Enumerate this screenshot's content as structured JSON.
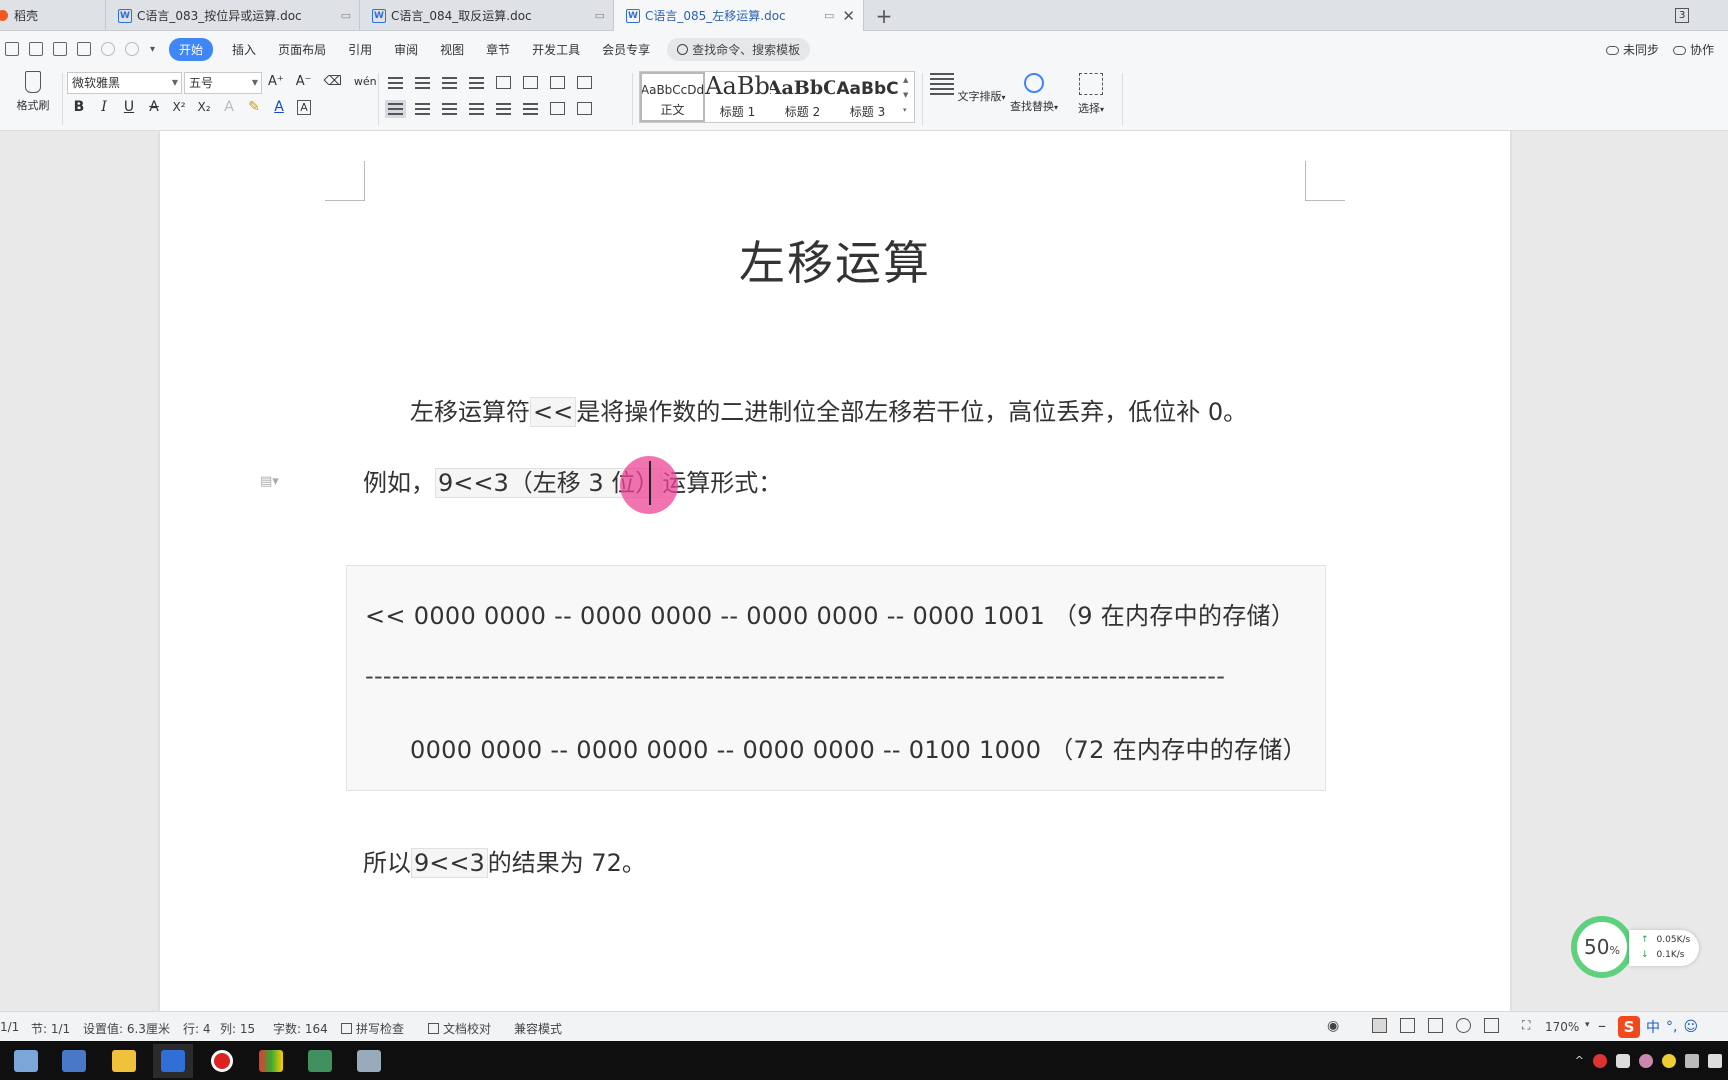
{
  "titlebar": {
    "tabs": [
      {
        "label": "稻壳",
        "active": false
      },
      {
        "label": "C语言_083_按位异或运算.doc",
        "active": false
      },
      {
        "label": "C语言_084_取反运算.doc",
        "active": false
      },
      {
        "label": "C语言_085_左移运算.doc",
        "active": true
      }
    ],
    "new_tab": "+",
    "tab_count": "3"
  },
  "menu": {
    "items": [
      "开始",
      "插入",
      "页面布局",
      "引用",
      "审阅",
      "视图",
      "章节",
      "开发工具",
      "会员专享"
    ],
    "search_placeholder": "查找命令、搜索模板",
    "sync_label": "未同步",
    "collab_label": "协作"
  },
  "ribbon": {
    "format_painter": "格式刷",
    "font_name": "微软雅黑",
    "font_size": "五号",
    "font_tools": [
      "A⁺",
      "A⁻",
      "⌫",
      "wén"
    ],
    "format_tools": [
      "B",
      "I",
      "U",
      "A",
      "X²",
      "X₂",
      "A",
      "✎",
      "A",
      "A"
    ],
    "styles": [
      {
        "sample": "AaBbCcDd",
        "label": "正文"
      },
      {
        "sample": "AaBb",
        "label": "标题 1"
      },
      {
        "sample": "AaBbC",
        "label": "标题 2"
      },
      {
        "sample": "AaBbC",
        "label": "标题 3"
      }
    ],
    "text_layout": "文字排版",
    "find_replace": "查找替换",
    "select": "选择"
  },
  "document": {
    "title": "左移运算",
    "para1_pre": "左移运算符",
    "para1_code": "<<",
    "para1_post": "是将操作数的二进制位全部左移若干位，高位丢弃，低位补 0。",
    "para2_pre": "例如，",
    "para2_code": "9<<3（左移 3 位）",
    "para2_post": "运算形式：",
    "code_line1": "<< 0000 0000 -- 0000 0000 -- 0000 0000 -- 0000 1001  （9  在内存中的存储）",
    "code_line2": "------------------------------------------------------------------------------------------------------",
    "code_line3": "0000 0000 -- 0000 0000 -- 0000 0000 -- 0100 1000  （72  在内存中的存储）",
    "para3_pre": "所以",
    "para3_code": "9<<3",
    "para3_post": "的结果为  72。"
  },
  "net_widget": {
    "percent": "50",
    "percent_sign": "%",
    "upload": "0.05K/s",
    "download": "0.1K/s"
  },
  "status": {
    "page": "1/1",
    "section": "节: 1/1",
    "setting": "设置值: 6.3厘米",
    "row": "行: 4",
    "col": "列: 15",
    "word_count": "字数: 164",
    "spell_check": "拼写检查",
    "doc_proof": "文档校对",
    "compat_mode": "兼容模式",
    "zoom": "170%",
    "minus": "–",
    "plus": "+",
    "ime": "中"
  },
  "colors": {
    "accent": "#3f86f7",
    "highlight": "#ec4696",
    "net_ring": "#5fd17c"
  }
}
